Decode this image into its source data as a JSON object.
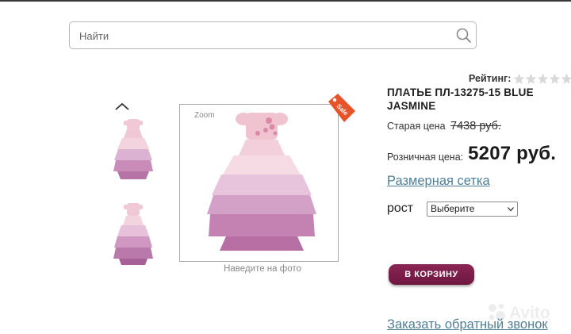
{
  "search": {
    "placeholder": "Найти",
    "value": "",
    "icon": "search-icon"
  },
  "gallery": {
    "scroll_up_icon": "chevron-up-icon",
    "zoom_label": "Zoom",
    "sale_badge": "Sale",
    "hover_hint": "Наведите на фото"
  },
  "product": {
    "rating_label": "Рейтинг:",
    "rating_value": 0,
    "rating_max": 5,
    "title": "ПЛАТЬЕ ПЛ-13275-15 BLUE JASMINE",
    "old_price_label": "Старая цена",
    "old_price_value": "7438 руб.",
    "retail_label": "Розничная цена:",
    "retail_value": "5207 руб.",
    "size_chart_link": "Размерная сетка",
    "height_label": "рост",
    "height_select_value": "Выберите",
    "cart_button": "В КОРЗИНУ",
    "callback_link": "Заказать обратный звонок"
  },
  "colors": {
    "accent": "#7a1c48",
    "link": "#4f7f98",
    "sale_badge": "#e8542a",
    "dress_pink": "#c98bb8"
  }
}
